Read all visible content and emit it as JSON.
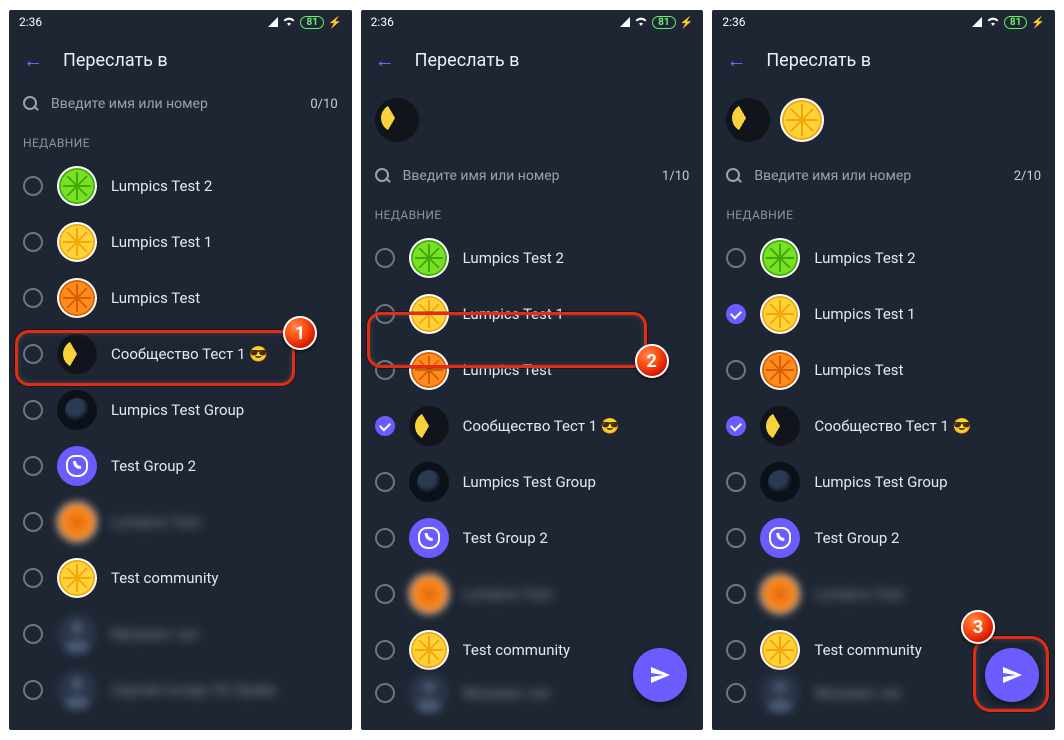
{
  "status": {
    "time": "2:36",
    "battery": "81"
  },
  "app": {
    "title": "Переслать в"
  },
  "search": {
    "placeholder": "Введите имя или номер"
  },
  "section": {
    "recent": "НЕДАВНИЕ"
  },
  "counters": {
    "s1": "0/10",
    "s2": "1/10",
    "s3": "2/10"
  },
  "contacts": {
    "lumpics_test_2": "Lumpics Test 2",
    "lumpics_test_1": "Lumpics Test 1",
    "lumpics_test": "Lumpics Test",
    "community_test_1": "Сообщество Тест 1 😎",
    "lumpics_test_group": "Lumpics Test Group",
    "test_group_2": "Test Group 2",
    "test_community": "Test community",
    "blurred_a": "Lumpics Test",
    "blurred_b": "Матрикс чат",
    "blurred_c": "Сергей Солар ТБ Прайз",
    "blurred_d": "Матрикс чат"
  },
  "badges": {
    "b1": "1",
    "b2": "2",
    "b3": "3"
  }
}
